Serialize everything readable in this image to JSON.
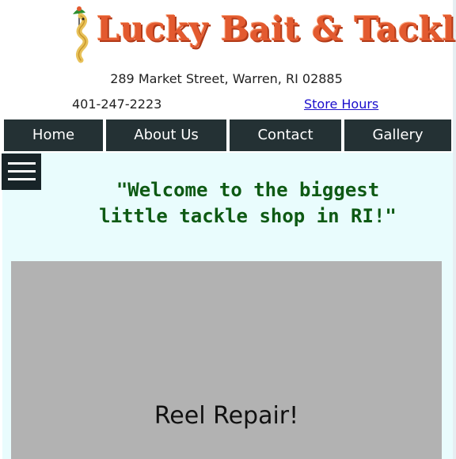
{
  "header": {
    "logo_text": "Lucky Bait & Tackle",
    "address": "289 Market Street, Warren, RI 02885",
    "phone": "401-247-2223",
    "hours_link": "Store Hours"
  },
  "nav": {
    "items": [
      {
        "label": "Home"
      },
      {
        "label": "About Us"
      },
      {
        "label": "Contact"
      },
      {
        "label": "Gallery"
      }
    ]
  },
  "main": {
    "menu_icon": "hamburger-menu-icon",
    "welcome": "\"Welcome to the biggest little tackle shop in RI!\"",
    "slideshow": {
      "caption": "Reel Repair!"
    }
  },
  "colors": {
    "nav_bg": "#243134",
    "content_bg": "#e9fcfd",
    "welcome_text": "#0e5a14",
    "logo_orange": "#e35a2f",
    "link": "#1a0dcc"
  }
}
